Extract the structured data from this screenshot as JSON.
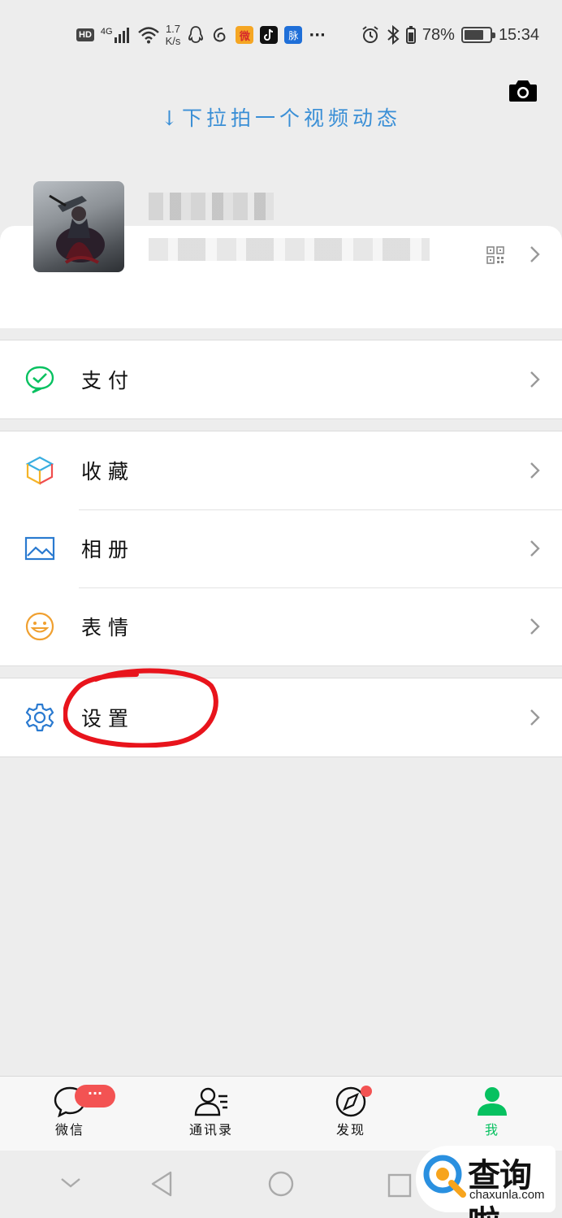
{
  "status_bar": {
    "network_badge": "HD",
    "signal_label": "4G",
    "speed_value": "1.7",
    "speed_unit": "K/s",
    "app_icon_weibo": "微",
    "app_icon_mai": "脉",
    "more": "···",
    "battery_percent": "78%",
    "time": "15:34",
    "battery_level": 0.78
  },
  "header": {
    "pull_hint": "↓下拉拍一个视频动态",
    "camera_icon": "camera-icon"
  },
  "profile": {
    "name": "",
    "wechat_id": "",
    "qr_icon": "qr-code-icon"
  },
  "menu": {
    "pay": {
      "label": "支付",
      "icon": "wechat-pay-icon",
      "color": "#07c160"
    },
    "favorites": {
      "label": "收藏",
      "icon": "favorites-cube-icon"
    },
    "album": {
      "label": "相册",
      "icon": "album-icon",
      "color": "#2a7ad0"
    },
    "stickers": {
      "label": "表情",
      "icon": "smiley-icon",
      "color": "#f0a030"
    },
    "settings": {
      "label": "设置",
      "icon": "gear-icon",
      "color": "#2a7ad0"
    }
  },
  "tabbar": {
    "chats": {
      "label": "微信",
      "badge": "···"
    },
    "contacts": {
      "label": "通讯录"
    },
    "discover": {
      "label": "发现"
    },
    "me": {
      "label": "我"
    },
    "active_color": "#07c160",
    "badge_color": "#f35353"
  },
  "watermark": {
    "brand": "查询啦",
    "url": "chaxunla.com"
  }
}
